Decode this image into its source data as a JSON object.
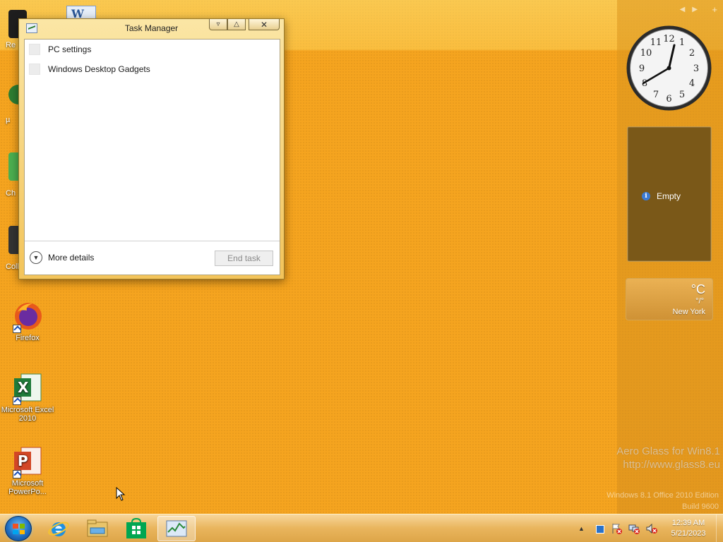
{
  "desktop": {
    "icons": [
      {
        "label_line1": "Firefox",
        "label_line2": ""
      },
      {
        "label_line1": "Microsoft Excel",
        "label_line2": "2010"
      },
      {
        "label_line1": "Microsoft",
        "label_line2": "PowerPo..."
      }
    ],
    "partial_labels": [
      "Re",
      "µ",
      "Ch",
      "Coll"
    ]
  },
  "task_manager": {
    "title": "Task Manager",
    "processes": [
      "PC settings",
      "Windows Desktop Gadgets"
    ],
    "more_details_label": "More details",
    "end_task_label": "End task"
  },
  "gadgets": {
    "notes_text": "Empty",
    "weather": {
      "temp": "°C",
      "range": "°/°",
      "city": "New York"
    }
  },
  "watermark": {
    "line1": "Aero Glass for Win8.1",
    "line2": "http://www.glass8.eu"
  },
  "edition": {
    "line1": "Windows 8.1 Office 2010 Edition",
    "line2": "Build 9600"
  },
  "taskbar": {
    "pinned": [
      "internet-explorer-icon",
      "file-explorer-icon",
      "store-icon",
      "task-manager-icon"
    ],
    "clock_time": "12:39 AM",
    "clock_date": "5/21/2023"
  },
  "colors": {
    "desktop": "#f5a41f",
    "taskbar": "#e9b55d",
    "accent": "#1f6fc2"
  }
}
